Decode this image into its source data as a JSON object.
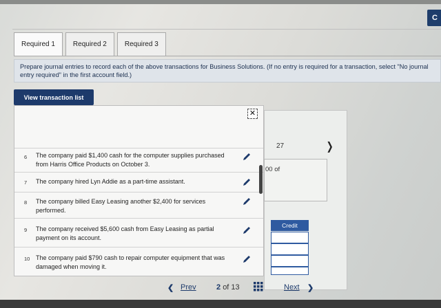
{
  "corner_button": "C",
  "tabs": [
    {
      "label": "Required 1",
      "active": true
    },
    {
      "label": "Required 2",
      "active": false
    },
    {
      "label": "Required 3",
      "active": false
    }
  ],
  "instruction": "Prepare journal entries to record each of the above transactions for Business Solutions. (If no entry is required for a transaction, select \"No journal entry required\" in the first account field.)",
  "view_button": "View transaction list",
  "popup": {
    "close_label": "✕",
    "transactions": [
      {
        "num": "6",
        "text": "The company paid $1,400 cash for the computer supplies purchased from Harris Office Products on October 3."
      },
      {
        "num": "7",
        "text": "The company hired Lyn Addie as a part-time assistant."
      },
      {
        "num": "8",
        "text": "The company billed Easy Leasing another $2,400 for services performed."
      },
      {
        "num": "9",
        "text": "The company received $5,600 cash from Easy Leasing as partial payment on its account."
      },
      {
        "num": "10",
        "text": "The company paid $790 cash to repair computer equipment that was damaged when moving it."
      }
    ]
  },
  "worksheet": {
    "date_fragment": "27",
    "desc_fragment": "00 of",
    "credit_header": "Credit"
  },
  "pagination": {
    "prev": "Prev",
    "current": "2",
    "of_label": "of 13",
    "next": "Next"
  }
}
